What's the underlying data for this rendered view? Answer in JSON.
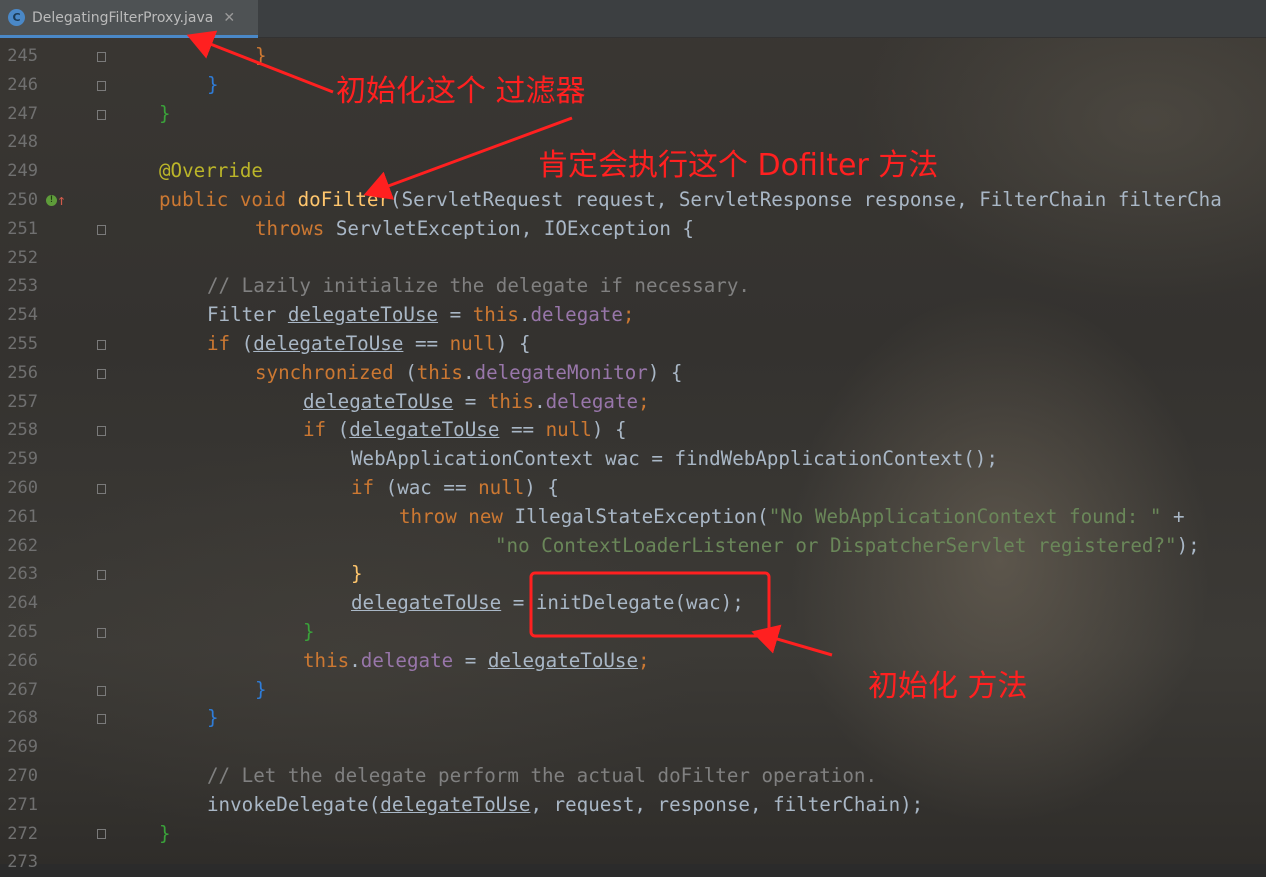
{
  "editor": {
    "tab": {
      "icon_letter": "C",
      "title": "DelegatingFilterProxy.java",
      "close_glyph": "✕"
    },
    "line_numbers": [
      "245",
      "246",
      "247",
      "248",
      "249",
      "250",
      "251",
      "252",
      "253",
      "254",
      "255",
      "256",
      "257",
      "258",
      "259",
      "260",
      "261",
      "262",
      "263",
      "264",
      "265",
      "266",
      "267",
      "268",
      "269",
      "270",
      "271",
      "272",
      "273"
    ],
    "line_marker_250": "!↑",
    "code": {
      "l245": "}",
      "l246": "}",
      "l247": "}",
      "l249": "@Override",
      "l250": [
        "public void ",
        "doFilter",
        "(ServletRequest request, ServletResponse response, FilterChain filterCha"
      ],
      "l251": [
        "throws ",
        "ServletException, IOException {"
      ],
      "l253": "// Lazily initialize the delegate if necessary.",
      "l254": [
        "Filter ",
        "delegateToUse",
        " = ",
        "this",
        ".",
        "delegate",
        ";"
      ],
      "l255": [
        "if ",
        "(",
        "delegateToUse",
        " == ",
        "null",
        ") {"
      ],
      "l256": [
        "synchronized ",
        "(",
        "this",
        ".",
        "delegateMonitor",
        ") {"
      ],
      "l257": [
        "delegateToUse",
        " = ",
        "this",
        ".",
        "delegate",
        ";"
      ],
      "l258": [
        "if ",
        "(",
        "delegateToUse",
        " == ",
        "null",
        ") {"
      ],
      "l259": "WebApplicationContext wac = findWebApplicationContext();",
      "l260": [
        "if ",
        "(wac == ",
        "null",
        ") {"
      ],
      "l261": [
        "throw new ",
        "IllegalStateException(",
        "\"No WebApplicationContext found: \"",
        " +"
      ],
      "l262": [
        "\"no ContextLoaderListener or DispatcherServlet registered?\"",
        ");"
      ],
      "l263": "}",
      "l264": [
        "delegateToUse",
        " = initDelegate(wac);"
      ],
      "l265": "}",
      "l266": [
        "this",
        ".",
        "delegate",
        " = ",
        "delegateToUse",
        ";"
      ],
      "l267": "}",
      "l268": "}",
      "l270": "// Let the delegate perform the actual doFilter operation.",
      "l271": [
        "invokeDelegate(",
        "delegateToUse",
        ", request, response, filterChain);"
      ],
      "l272": "}"
    }
  },
  "annotations": {
    "note_init_filter": "初始化这个 过滤器",
    "note_dofilter": "肯定会执行这个 Dofilter 方法",
    "note_init_method": "初始化 方法",
    "color": "#ff2020"
  }
}
